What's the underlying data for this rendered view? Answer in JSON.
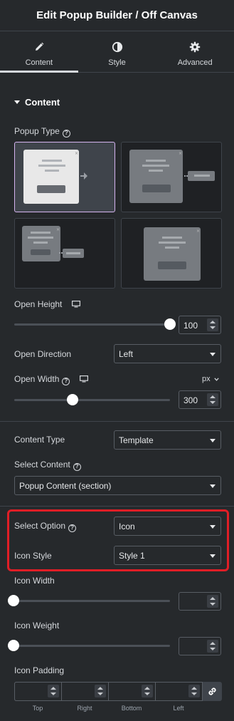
{
  "header": {
    "title": "Edit Popup Builder / Off Canvas"
  },
  "tabs": [
    {
      "label": "Content",
      "icon": "pencil-icon",
      "active": true
    },
    {
      "label": "Style",
      "icon": "half-circle-icon",
      "active": false
    },
    {
      "label": "Advanced",
      "icon": "gear-icon",
      "active": false
    }
  ],
  "section": {
    "title": "Content"
  },
  "popup_type": {
    "label": "Popup Type",
    "selected_index": 0
  },
  "open_height": {
    "label": "Open Height",
    "value": "100",
    "level": 1.0
  },
  "open_direction": {
    "label": "Open Direction",
    "value": "Left"
  },
  "open_width": {
    "label": "Open Width",
    "unit": "px",
    "value": "300",
    "level": 0.35
  },
  "content_type": {
    "label": "Content Type",
    "value": "Template"
  },
  "select_content": {
    "label": "Select Content",
    "value": "Popup Content (section)"
  },
  "select_option": {
    "label": "Select Option",
    "value": "Icon"
  },
  "icon_style": {
    "label": "Icon Style",
    "value": "Style 1"
  },
  "icon_width": {
    "label": "Icon Width",
    "value": ""
  },
  "icon_weight": {
    "label": "Icon Weight",
    "value": ""
  },
  "icon_padding": {
    "label": "Icon Padding",
    "sides": [
      "Top",
      "Right",
      "Bottom",
      "Left"
    ]
  },
  "colors": {
    "background": "#26292c",
    "accent_border": "#d6b4f0",
    "highlight": "#e01e26"
  }
}
